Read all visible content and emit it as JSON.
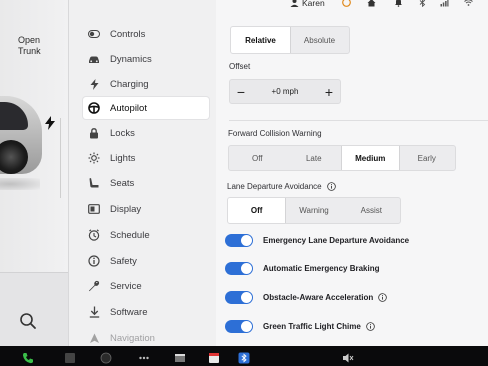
{
  "car": {
    "open_trunk_line1": "Open",
    "open_trunk_line2": "Trunk"
  },
  "status_bar": {
    "user_name": "Karen"
  },
  "menu": {
    "items": [
      {
        "label": "Controls",
        "icon": "toggle-icon"
      },
      {
        "label": "Dynamics",
        "icon": "car-icon"
      },
      {
        "label": "Charging",
        "icon": "bolt-icon"
      },
      {
        "label": "Autopilot",
        "icon": "steering-wheel-icon",
        "active": true
      },
      {
        "label": "Locks",
        "icon": "lock-icon"
      },
      {
        "label": "Lights",
        "icon": "sun-icon"
      },
      {
        "label": "Seats",
        "icon": "seat-icon"
      },
      {
        "label": "Display",
        "icon": "display-icon"
      },
      {
        "label": "Schedule",
        "icon": "clock-icon"
      },
      {
        "label": "Safety",
        "icon": "info-icon"
      },
      {
        "label": "Service",
        "icon": "wrench-icon"
      },
      {
        "label": "Software",
        "icon": "download-icon"
      },
      {
        "label": "Navigation",
        "icon": "navigation-icon"
      }
    ]
  },
  "speed_display": {
    "options": [
      "Relative",
      "Absolute"
    ],
    "selected": "Relative"
  },
  "offset": {
    "label": "Offset",
    "value": "+0 mph",
    "minus": "−",
    "plus": "+"
  },
  "forward_collision": {
    "label": "Forward Collision Warning",
    "options": [
      "Off",
      "Late",
      "Medium",
      "Early"
    ],
    "selected": "Medium"
  },
  "lane_departure": {
    "label": "Lane Departure Avoidance",
    "options": [
      "Off",
      "Warning",
      "Assist"
    ],
    "selected": "Off"
  },
  "toggles": [
    {
      "label": "Emergency Lane Departure Avoidance",
      "on": true,
      "info": false
    },
    {
      "label": "Automatic Emergency Braking",
      "on": true,
      "info": false
    },
    {
      "label": "Obstacle-Aware Acceleration",
      "on": true,
      "info": true
    },
    {
      "label": "Green Traffic Light Chime",
      "on": true,
      "info": true
    }
  ],
  "colors": {
    "accent": "#2d6fd6",
    "background": "#f6f6f7",
    "dock": "#0a0a0c"
  }
}
